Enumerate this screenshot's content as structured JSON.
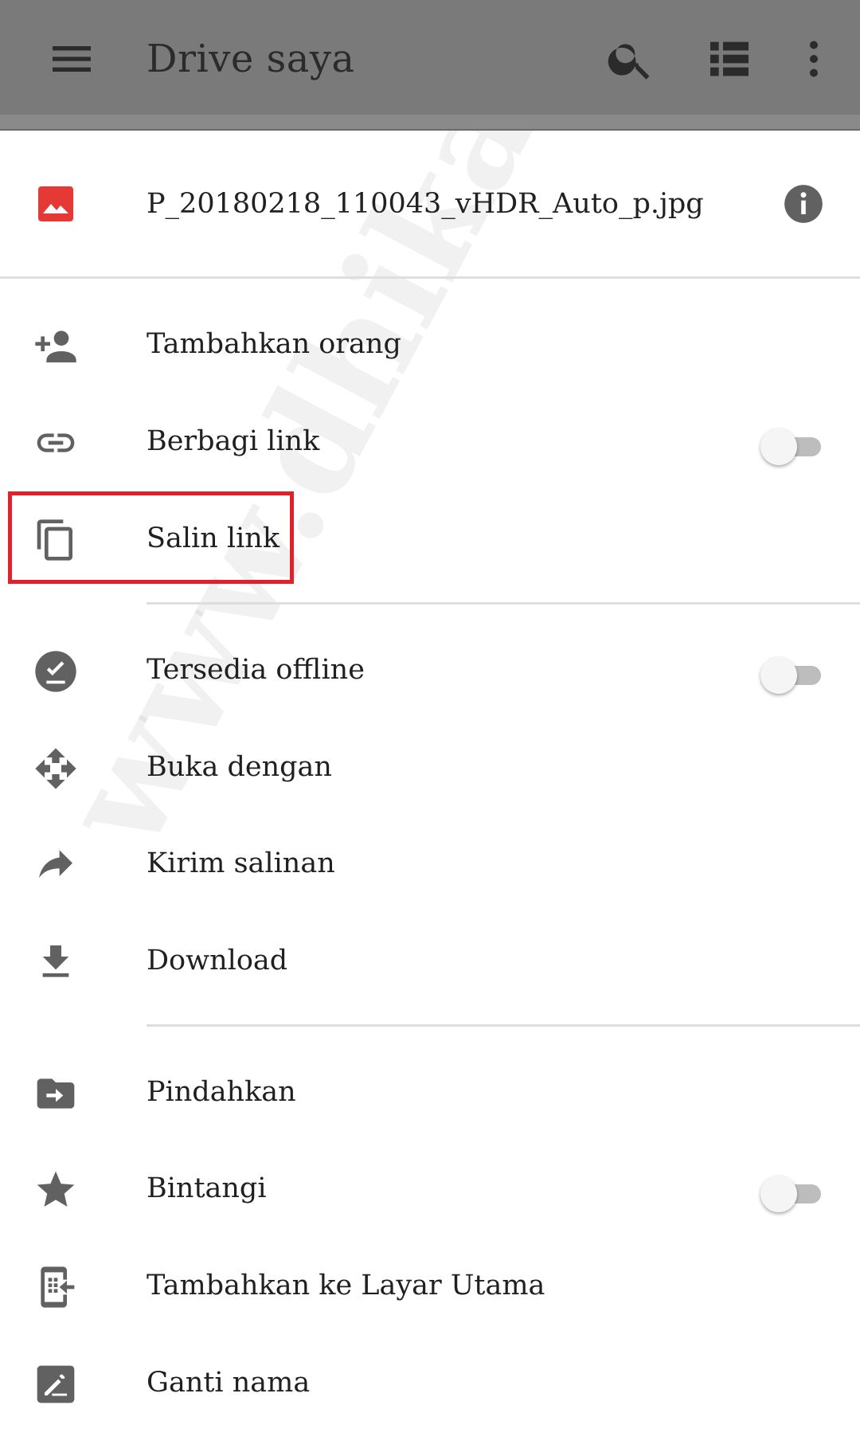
{
  "appbar": {
    "title": "Drive saya",
    "icons": [
      "menu-icon",
      "search-icon",
      "list-view-icon",
      "more-vert-icon"
    ]
  },
  "file": {
    "name": "P_20180218_110043_vHDR_Auto_p.jpg",
    "icon": "image-file-icon",
    "accent": "#e53935"
  },
  "menu": {
    "add_people": "Tambahkan orang",
    "share_link": "Berbagi link",
    "copy_link": "Salin link",
    "offline": "Tersedia offline",
    "open_with": "Buka dengan",
    "send_copy": "Kirim salinan",
    "download": "Download",
    "move": "Pindahkan",
    "star": "Bintangi",
    "add_home": "Tambahkan ke Layar Utama",
    "rename": "Ganti nama"
  },
  "toggles": {
    "share_link": false,
    "offline": false,
    "star": false
  },
  "highlight_color": "#e0202a",
  "watermark": "www.dhikadwipradya.com"
}
